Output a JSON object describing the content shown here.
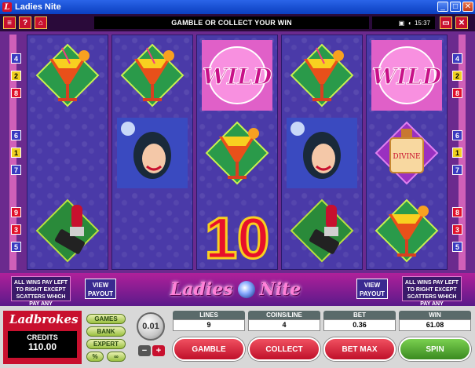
{
  "window": {
    "title": "Ladies Nite",
    "logo_letter": "L",
    "buttons": [
      "_",
      "□",
      "✕"
    ]
  },
  "topbar": {
    "left_icons": [
      "≡",
      "?",
      "⌂"
    ],
    "message": "GAMBLE OR COLLECT YOUR WIN",
    "time": "15:37",
    "right_icons": [
      "▭",
      "✕"
    ]
  },
  "line_numbers": {
    "left": [
      "4",
      "2",
      "8",
      "6",
      "1",
      "7",
      "9",
      "3",
      "5"
    ],
    "right": [
      "4",
      "2",
      "8",
      "6",
      "1",
      "7",
      "8",
      "3",
      "5"
    ]
  },
  "reels": [
    [
      "cocktail",
      "",
      "lipstick"
    ],
    [
      "cocktail",
      "ladies-nite-woman",
      ""
    ],
    [
      "wild",
      "cocktail",
      "scatter-10"
    ],
    [
      "cocktail",
      "ladies-nite-woman",
      "lipstick"
    ],
    [
      "wild",
      "divine-perfume",
      "cocktail"
    ]
  ],
  "symbols": {
    "wild_label": "WILD",
    "scatter_label": "10",
    "perfume_label": "DIVINE"
  },
  "paybar": {
    "note": "ALL WINS PAY LEFT TO RIGHT EXCEPT SCATTERS WHICH PAY ANY",
    "view_payout": "VIEW PAYOUT",
    "logo_left": "Ladies",
    "logo_right": "Nite"
  },
  "bottom": {
    "brand": "Ladbrokes",
    "credits_label": "CREDITS",
    "credits_value": "110.00",
    "menu": [
      "GAMES",
      "BANK",
      "EXPERT"
    ],
    "pct_label": "%",
    "coin_value": "0.01",
    "coin_minus": "−",
    "coin_plus": "+",
    "stats": [
      {
        "label": "LINES",
        "value": "9"
      },
      {
        "label": "COINS/LINE",
        "value": "4"
      },
      {
        "label": "BET",
        "value": "0.36"
      },
      {
        "label": "WIN",
        "value": "61.08"
      }
    ],
    "actions": [
      "GAMBLE",
      "COLLECT",
      "BET MAX",
      "SPIN"
    ]
  },
  "colors": {
    "brand_red": "#c8102e",
    "spin_green": "#3a8a20",
    "reel_bg": "#4a3aa8"
  }
}
